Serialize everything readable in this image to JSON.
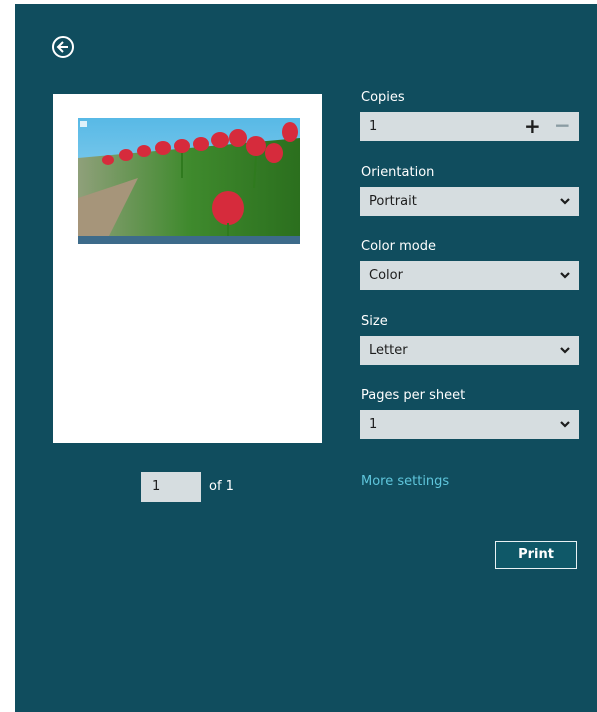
{
  "preview": {
    "page_number": "1",
    "page_total": "of 1"
  },
  "options": {
    "copies": {
      "label": "Copies",
      "value": "1",
      "plus_icon": "plus-icon",
      "minus_icon": "minus-icon"
    },
    "orientation": {
      "label": "Orientation",
      "value": "Portrait"
    },
    "color_mode": {
      "label": "Color mode",
      "value": "Color"
    },
    "size": {
      "label": "Size",
      "value": "Letter"
    },
    "pages_per_sheet": {
      "label": "Pages per sheet",
      "value": "1"
    }
  },
  "links": {
    "more_settings": "More settings"
  },
  "actions": {
    "print": "Print"
  },
  "colors": {
    "background": "#104d5e",
    "field": "#d6dde0",
    "link": "#5fc6dc"
  }
}
